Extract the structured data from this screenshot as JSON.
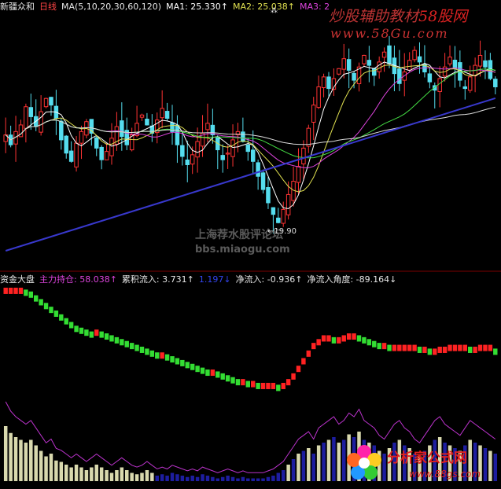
{
  "header_top": {
    "title": "新疆众和",
    "period": "日线",
    "ma_def": "MA(5,10,20,30,60,120)",
    "ma1": "MA1: 25.330↑",
    "ma2": "MA2: 25.038↑",
    "ma3": "MA3: 2"
  },
  "header_bottom": {
    "indicator": "资金大盘",
    "main_pos": "主力持仓: 58.038↑",
    "cum_inflow": "累积流入: 3.731↑",
    "hidden_item": "1.197↓",
    "net_inflow": "净流入: -0.936↑",
    "net_angle": "净流入角度: -89.164↓"
  },
  "annotations": {
    "low_price": "19.90",
    "star": "⁂"
  },
  "watermarks": {
    "top_brand": "炒股辅助教材",
    "top_brand_num": "58股网",
    "top_url": "www.58Gu.com",
    "mid_cn": "上海荐水股评论坛",
    "mid_url": "bbs.miaogu.com",
    "bottom_brand": "分析家公式网",
    "bottom_url": "www.88gs.com"
  },
  "colors": {
    "up": "#ff3333",
    "down": "#55ddee",
    "ma5": "#ffffff",
    "ma10": "#e0e050",
    "ma20": "#dd44dd",
    "ma30": "#44dd44",
    "ma60": "#dddddd",
    "ma120": "#3838cc",
    "step_up": "#ff2222",
    "step_down": "#33dd33",
    "purple": "#bb33cc",
    "bar_pale": "#ffffcc",
    "bar_blue": "#2222bb"
  },
  "chart_data": {
    "type": "line",
    "price_close": [
      25.4,
      24.8,
      25.6,
      26.0,
      27.1,
      26.5,
      25.9,
      26.8,
      27.6,
      27.2,
      26.4,
      25.1,
      24.3,
      23.8,
      24.9,
      25.6,
      26.2,
      25.5,
      24.6,
      23.9,
      24.4,
      25.2,
      25.9,
      25.3,
      24.8,
      25.4,
      26.1,
      26.6,
      26.0,
      25.5,
      26.3,
      27.0,
      26.4,
      25.6,
      24.8,
      24.1,
      23.6,
      24.2,
      25.0,
      25.5,
      26.1,
      25.4,
      24.5,
      23.9,
      24.3,
      25.1,
      25.6,
      25.0,
      24.4,
      23.8,
      22.9,
      22.1,
      21.3,
      20.6,
      20.1,
      20.9,
      21.8,
      22.6,
      23.5,
      24.6,
      25.8,
      27.2,
      28.3,
      28.9,
      28.2,
      28.8,
      29.4,
      30.0,
      29.3,
      28.7,
      29.5,
      30.2,
      29.6,
      29.0,
      29.8,
      30.4,
      29.7,
      29.1,
      28.5,
      29.2,
      29.9,
      30.5,
      29.8,
      29.2,
      28.6,
      28.1,
      28.8,
      29.5,
      30.1,
      29.4,
      28.7,
      28.2,
      28.9,
      29.6,
      30.2,
      29.5,
      28.8,
      28.3
    ],
    "price_low_marker": 19.9,
    "main_position": [
      100,
      100,
      100,
      100,
      99,
      98,
      96,
      94,
      92,
      90,
      88,
      86,
      84,
      82,
      80,
      79,
      78,
      77,
      78,
      77,
      76,
      75,
      74,
      73,
      72,
      71,
      70,
      69,
      68,
      67,
      66,
      66,
      65,
      64,
      63,
      62,
      61,
      60,
      59,
      58,
      57,
      57,
      56,
      55,
      54,
      53,
      52,
      52,
      51,
      51,
      50,
      50,
      50,
      50,
      49,
      50,
      52,
      55,
      59,
      63,
      67,
      71,
      73,
      75,
      75,
      74,
      74,
      75,
      76,
      76,
      75,
      74,
      73,
      72,
      71,
      71,
      70,
      70,
      70,
      70,
      70,
      70,
      69,
      69,
      68,
      68,
      69,
      69,
      70,
      70,
      70,
      70,
      69,
      69,
      70,
      70,
      70,
      68
    ],
    "volume_proxy": [
      40,
      35,
      32,
      30,
      28,
      30,
      26,
      22,
      18,
      20,
      15,
      14,
      12,
      10,
      12,
      10,
      8,
      10,
      12,
      10,
      8,
      6,
      8,
      10,
      8,
      6,
      5,
      6,
      8,
      6,
      4,
      5,
      4,
      6,
      5,
      4,
      3,
      4,
      3,
      5,
      4,
      3,
      2,
      3,
      4,
      3,
      2,
      3,
      2,
      2,
      2,
      2,
      3,
      4,
      6,
      8,
      12,
      16,
      20,
      22,
      24,
      20,
      26,
      28,
      30,
      32,
      28,
      30,
      34,
      32,
      36,
      30,
      28,
      26,
      22,
      20,
      24,
      28,
      30,
      26,
      24,
      20,
      18,
      22,
      26,
      30,
      32,
      28,
      26,
      24,
      22,
      26,
      30,
      28,
      26,
      24,
      22,
      20
    ]
  }
}
